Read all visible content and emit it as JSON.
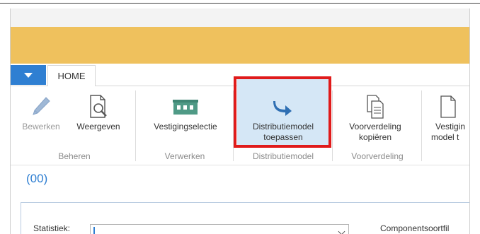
{
  "ribbon": {
    "app_menu_icon": "chevron-down-icon",
    "tabs": [
      {
        "label": "HOME"
      }
    ],
    "buttons": {
      "bewerken": {
        "label": "Bewerken",
        "icon": "pencil-icon",
        "enabled": false
      },
      "weergeven": {
        "label": "Weergeven",
        "icon": "document-magnifier-icon"
      },
      "vestigingsselectie": {
        "label": "Vestigingselectie",
        "icon": "store-icon"
      },
      "distributiemodel": {
        "line1": "Distributiemodel",
        "line2": "toepassen",
        "icon": "arrow-right-icon",
        "highlighted": true
      },
      "voorverdeling": {
        "line1": "Voorverdeling",
        "line2": "kopiëren",
        "icon": "copy-documents-icon"
      },
      "vestiging_model": {
        "line1": "Vestigin",
        "line2": "model t",
        "icon": "document-icon"
      }
    },
    "groups": {
      "beheren": "Beheren",
      "verwerken": "Verwerken",
      "distributiemodel": "Distributiemodel",
      "voorverdeling": "Voorverdeling"
    }
  },
  "record": {
    "title": "(00)"
  },
  "fields": {
    "statistiek": {
      "label": "Statistiek:",
      "value": ""
    },
    "componentsoort": {
      "label": "Componentsoortfil"
    }
  },
  "colors": {
    "accent_bar": "#efc15d",
    "app_menu": "#2f7fd2",
    "highlight_box": "#e01b1b",
    "selected_button": "#d5e7f6",
    "record_title": "#2f7fd2",
    "icon_green": "#4f9a86",
    "icon_blue": "#2f6fb3"
  }
}
